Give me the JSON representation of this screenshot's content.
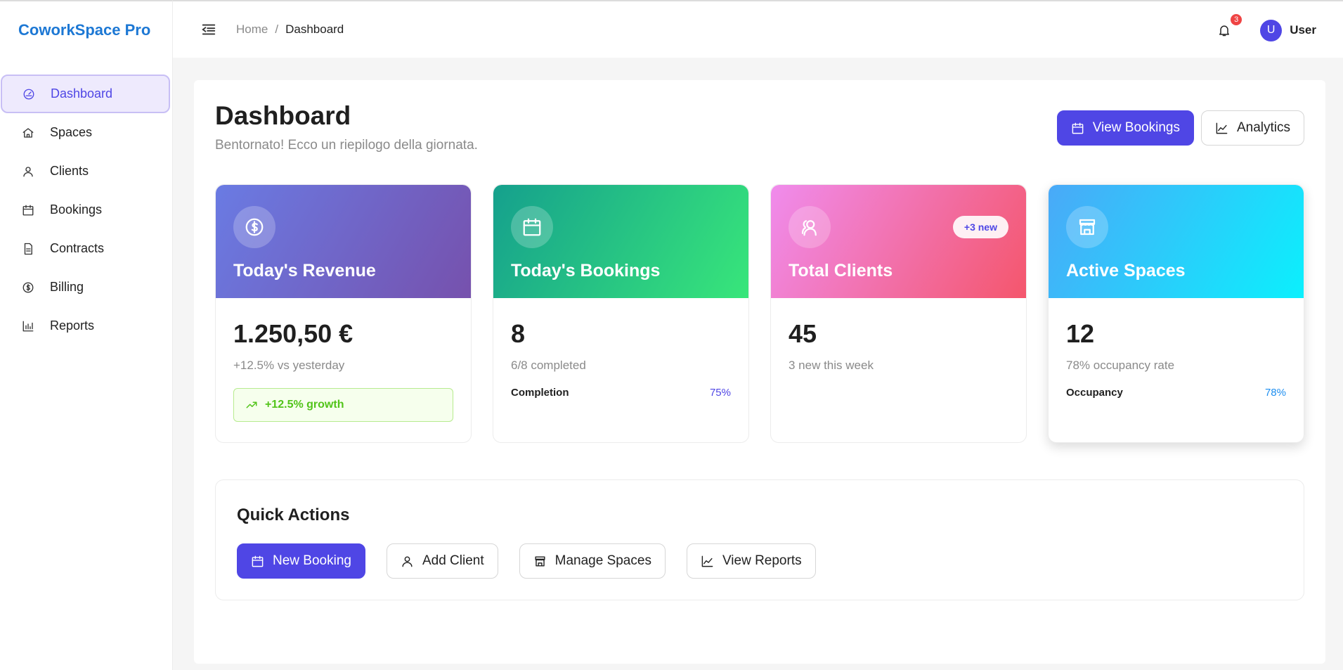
{
  "brand": "CoworkSpace Pro",
  "sidebar": {
    "items": [
      {
        "label": "Dashboard",
        "icon": "gauge-icon",
        "active": true
      },
      {
        "label": "Spaces",
        "icon": "home-icon"
      },
      {
        "label": "Clients",
        "icon": "user-icon"
      },
      {
        "label": "Bookings",
        "icon": "calendar-icon"
      },
      {
        "label": "Contracts",
        "icon": "document-icon"
      },
      {
        "label": "Billing",
        "icon": "dollar-circle-icon"
      },
      {
        "label": "Reports",
        "icon": "bar-chart-icon"
      }
    ]
  },
  "header": {
    "breadcrumb": {
      "home": "Home",
      "separator": "/",
      "current": "Dashboard"
    },
    "notifications": {
      "count": "3"
    },
    "user": {
      "initial": "U",
      "name": "User"
    }
  },
  "page": {
    "title": "Dashboard",
    "subtitle": "Bentornato! Ecco un riepilogo della giornata.",
    "actions": {
      "view_bookings": "View Bookings",
      "analytics": "Analytics"
    }
  },
  "cards": [
    {
      "title": "Today's Revenue",
      "value": "1.250,50 €",
      "sub": "+12.5% vs yesterday",
      "growth": "+12.5% growth",
      "icon": "dollar-circle-icon",
      "gradient": [
        "#6a7be3",
        "#7651ad"
      ]
    },
    {
      "title": "Today's Bookings",
      "value": "8",
      "sub": "6/8 completed",
      "metric_label": "Completion",
      "metric_value": "75%",
      "icon": "calendar-icon",
      "gradient": [
        "#15a08d",
        "#38e67a"
      ]
    },
    {
      "title": "Total Clients",
      "value": "45",
      "sub": "3 new this week",
      "badge": "+3 new",
      "icon": "users-icon",
      "gradient": [
        "#f08ced",
        "#f4566c"
      ]
    },
    {
      "title": "Active Spaces",
      "value": "12",
      "sub": "78% occupancy rate",
      "metric_label": "Occupancy",
      "metric_value": "78%",
      "icon": "shop-icon",
      "gradient": [
        "#4aa9f8",
        "#0bf0fd"
      ]
    }
  ],
  "quick_actions": {
    "title": "Quick Actions",
    "new_booking": "New Booking",
    "add_client": "Add Client",
    "manage_spaces": "Manage Spaces",
    "view_reports": "View Reports"
  },
  "colors": {
    "accent": "#4f46e5",
    "brand": "#1d78d4",
    "success": "#52c41a",
    "badge": "#ef4444"
  }
}
